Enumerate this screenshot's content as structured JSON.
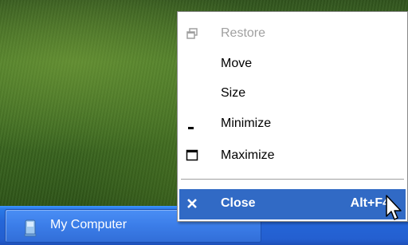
{
  "taskbar": {
    "button_label": "My Computer",
    "icon": "my-computer-icon"
  },
  "menu": {
    "items": [
      {
        "label": "Restore",
        "icon": "restore-icon",
        "enabled": false
      },
      {
        "label": "Move",
        "icon": "",
        "enabled": true
      },
      {
        "label": "Size",
        "icon": "",
        "enabled": true
      },
      {
        "label": "Minimize",
        "icon": "minimize-icon",
        "enabled": true
      },
      {
        "label": "Maximize",
        "icon": "maximize-icon",
        "enabled": true
      },
      {
        "label": "Close",
        "icon": "close-icon",
        "enabled": true,
        "shortcut": "Alt+F4",
        "highlighted": true
      }
    ]
  },
  "colors": {
    "highlight": "#316ac5",
    "taskbar": "#245fd0",
    "disabled_text": "#a0a0a0"
  }
}
